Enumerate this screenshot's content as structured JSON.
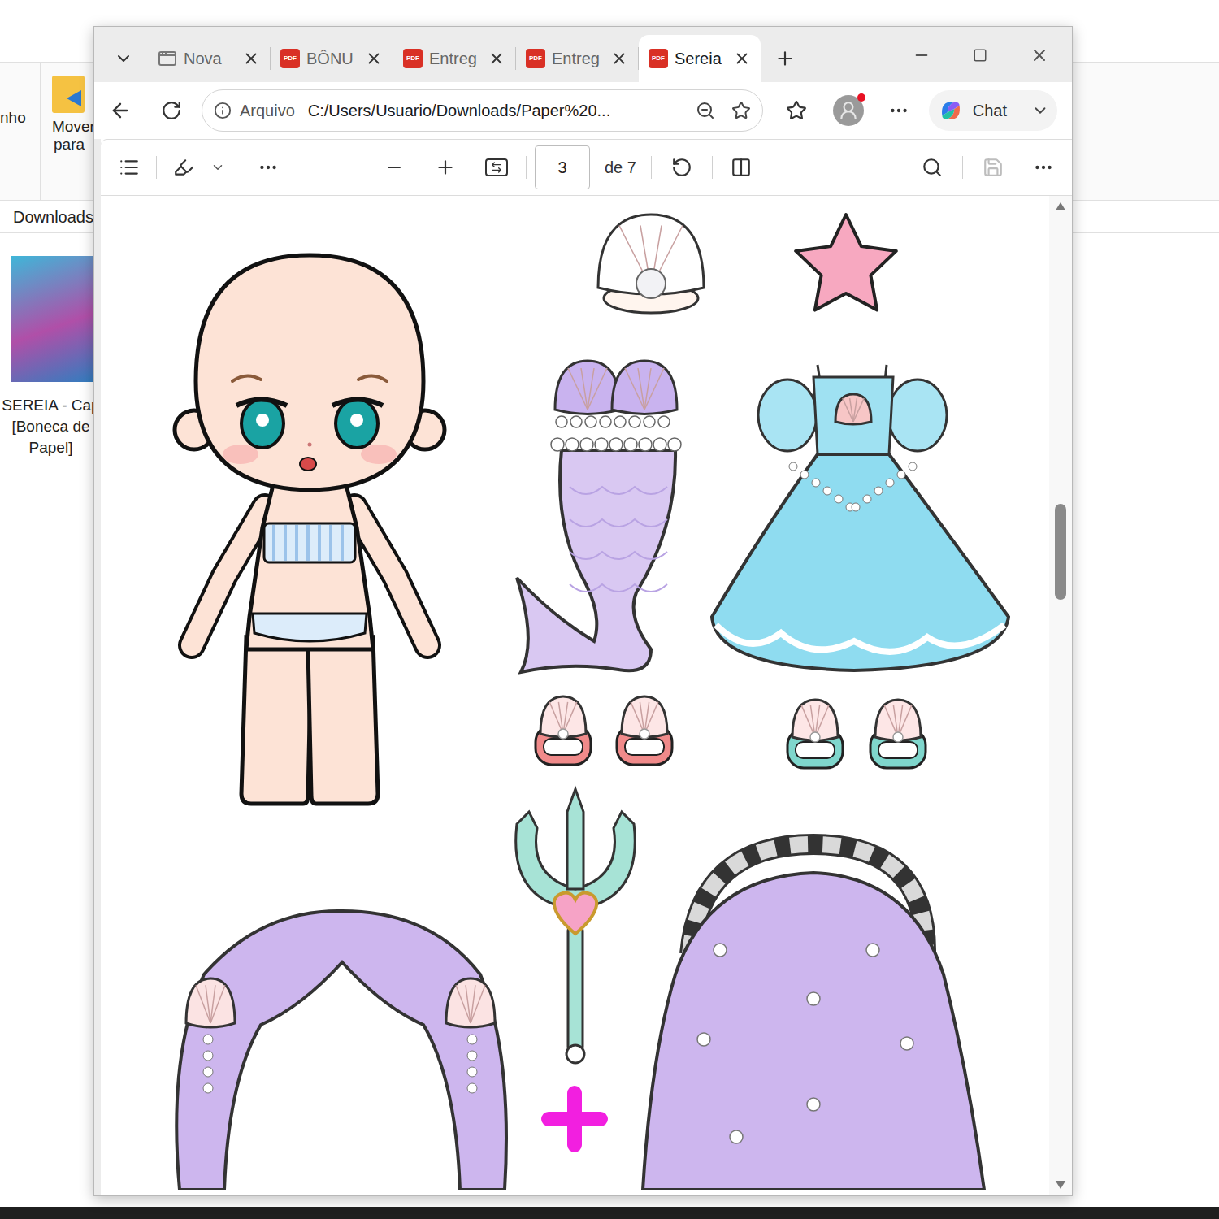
{
  "explorer": {
    "ribbon_cut": "nho",
    "move_button": [
      "Mover",
      "para"
    ],
    "breadcrumb": "Downloads",
    "file_caption": [
      "SEREIA - Cap",
      "[Boneca de",
      "Papel]"
    ]
  },
  "browser": {
    "tabs": [
      {
        "label": "Nova",
        "kind": "page",
        "selected": false
      },
      {
        "label": "BÔNU",
        "kind": "pdf",
        "selected": false
      },
      {
        "label": "Entreg",
        "kind": "pdf",
        "selected": false
      },
      {
        "label": "Entreg",
        "kind": "pdf",
        "selected": false
      },
      {
        "label": "Sereia",
        "kind": "pdf",
        "selected": true
      }
    ],
    "pdf_badge": "PDF",
    "address": {
      "scheme": "Arquivo",
      "url": "C:/Users/Usuario/Downloads/Paper%20..."
    },
    "profile_notification": true,
    "chat": "Chat"
  },
  "pdf_viewer": {
    "page": "3",
    "page_count": "de 7",
    "save_disabled": true,
    "scrollbar": {
      "position": 0.3,
      "size": 0.1
    }
  }
}
